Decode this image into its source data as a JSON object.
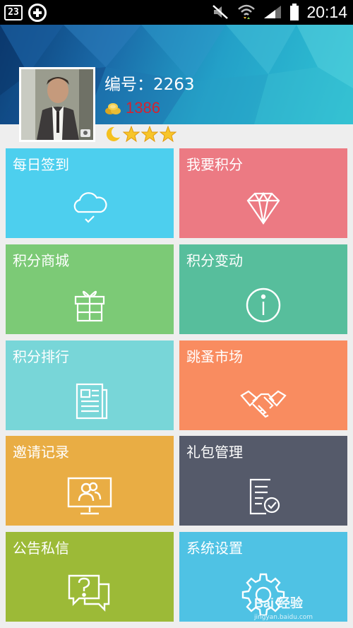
{
  "status_bar": {
    "notification_badge": "23",
    "time": "20:14"
  },
  "profile": {
    "id_label": "编号：2263",
    "coins": "1386",
    "level_icons": [
      "moon-icon",
      "star-icon",
      "star-icon",
      "star-icon"
    ]
  },
  "tiles": [
    {
      "label": "每日签到",
      "icon": "cloud-check-icon",
      "color": "#4dcfee"
    },
    {
      "label": "我要积分",
      "icon": "diamond-icon",
      "color": "#ec7a83"
    },
    {
      "label": "积分商城",
      "icon": "gift-icon",
      "color": "#7cca76"
    },
    {
      "label": "积分变动",
      "icon": "info-icon",
      "color": "#57be9c"
    },
    {
      "label": "积分排行",
      "icon": "newspaper-icon",
      "color": "#78d6d8"
    },
    {
      "label": "跳蚤市场",
      "icon": "handshake-icon",
      "color": "#f98c60"
    },
    {
      "label": "邀请记录",
      "icon": "monitor-users-icon",
      "color": "#e9ad44"
    },
    {
      "label": "礼包管理",
      "icon": "document-check-icon",
      "color": "#555a6a"
    },
    {
      "label": "公告私信",
      "icon": "chat-question-icon",
      "color": "#9cba37"
    },
    {
      "label": "系统设置",
      "icon": "gear-icon",
      "color": "#4fc2e4"
    }
  ],
  "watermark": {
    "brand": "Bai 经验",
    "url": "jingyan.baidu.com"
  }
}
